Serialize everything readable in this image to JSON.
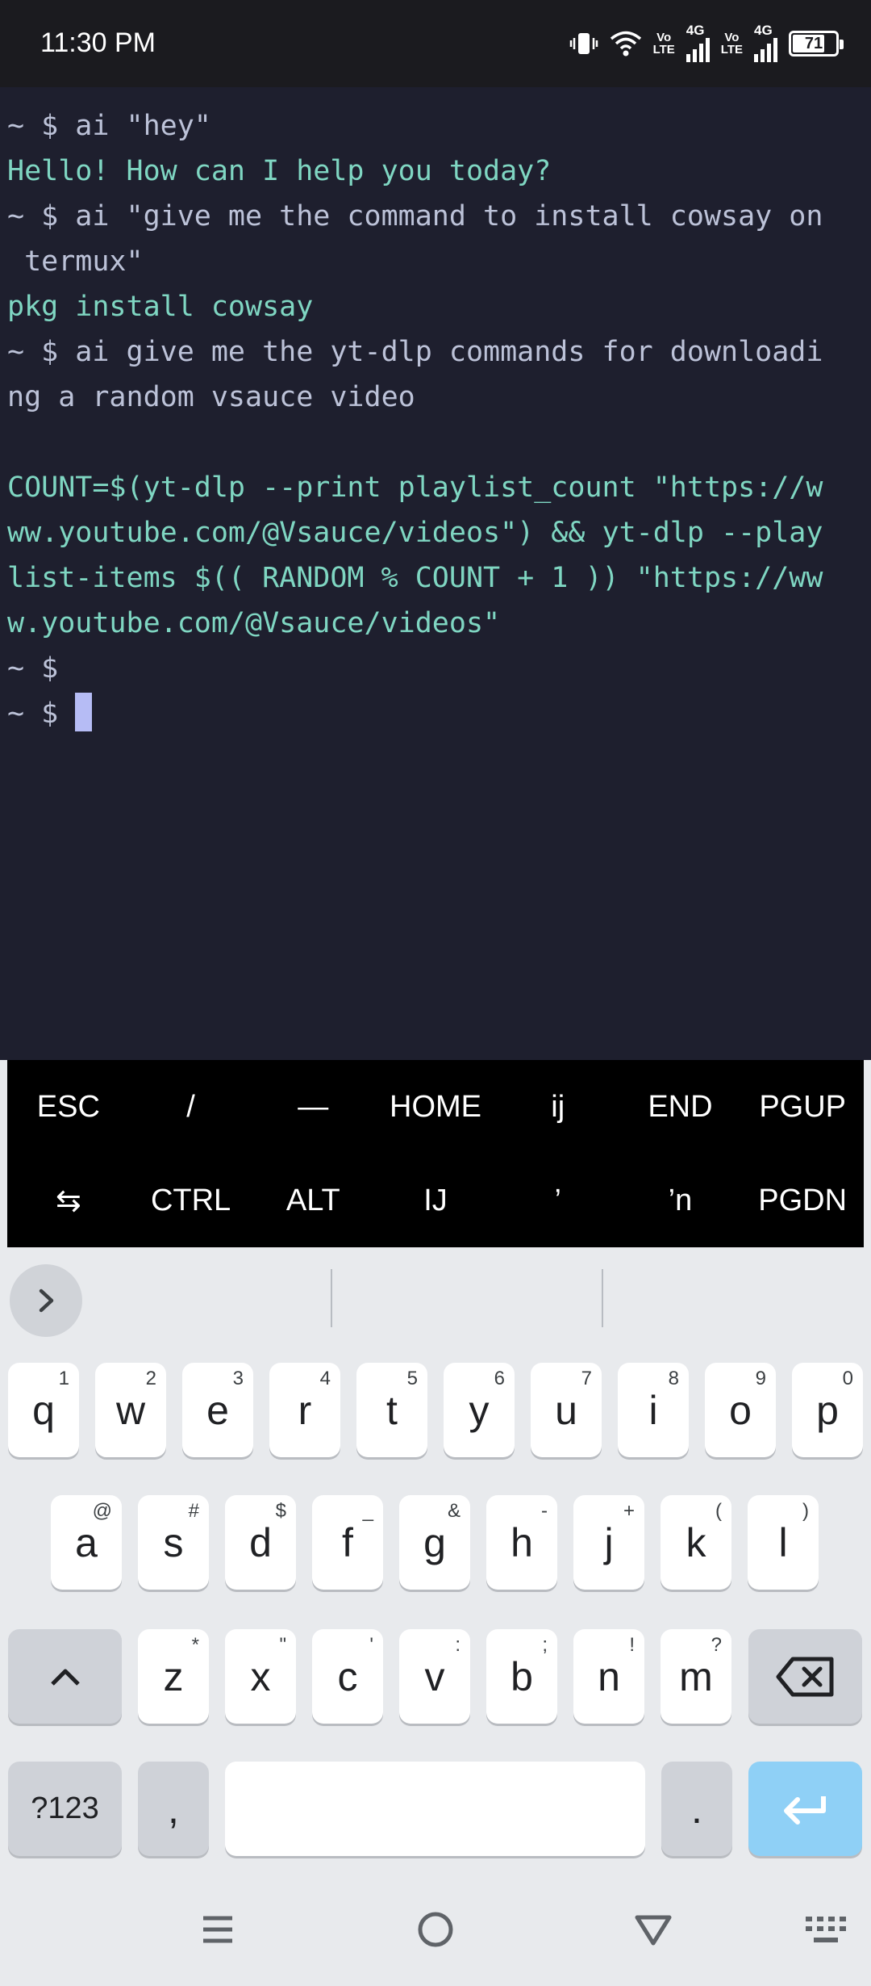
{
  "status_bar": {
    "time": "11:30 PM",
    "net1": "Vo\nLTE",
    "net1_a": "Vo",
    "net1_b": "LTE",
    "gen1": "4G",
    "net2_a": "Vo",
    "net2_b": "LTE",
    "gen2": "4G",
    "battery": "71"
  },
  "terminal": {
    "lines": [
      {
        "text": "~ $ ai \"hey\"",
        "kind": "prompt"
      },
      {
        "text": "Hello! How can I help you today?",
        "kind": "output"
      },
      {
        "text": "~ $ ai \"give me the command to install cowsay on",
        "kind": "prompt"
      },
      {
        "text": " termux\"",
        "kind": "prompt"
      },
      {
        "text": "pkg install cowsay",
        "kind": "output"
      },
      {
        "text": "~ $ ai give me the yt-dlp commands for downloadi",
        "kind": "prompt"
      },
      {
        "text": "ng a random vsauce video",
        "kind": "prompt"
      },
      {
        "text": "",
        "kind": "output"
      },
      {
        "text": "COUNT=$(yt-dlp --print playlist_count \"https://w",
        "kind": "output"
      },
      {
        "text": "ww.youtube.com/@Vsauce/videos\") && yt-dlp --play",
        "kind": "output"
      },
      {
        "text": "list-items $(( RANDOM % COUNT + 1 )) \"https://ww",
        "kind": "output"
      },
      {
        "text": "w.youtube.com/@Vsauce/videos\"",
        "kind": "output"
      },
      {
        "text": "~ $",
        "kind": "prompt"
      },
      {
        "text": "~ $ ",
        "kind": "prompt"
      }
    ]
  },
  "extra_keys": {
    "row1": [
      "ESC",
      "/",
      "—",
      "HOME",
      "ij",
      "END",
      "PGUP"
    ],
    "row2": [
      "⇆",
      "CTRL",
      "ALT",
      "IJ",
      "’",
      "’n",
      "PGDN"
    ]
  },
  "keyboard": {
    "row1": [
      {
        "k": "q",
        "h": "1"
      },
      {
        "k": "w",
        "h": "2"
      },
      {
        "k": "e",
        "h": "3"
      },
      {
        "k": "r",
        "h": "4"
      },
      {
        "k": "t",
        "h": "5"
      },
      {
        "k": "y",
        "h": "6"
      },
      {
        "k": "u",
        "h": "7"
      },
      {
        "k": "i",
        "h": "8"
      },
      {
        "k": "o",
        "h": "9"
      },
      {
        "k": "p",
        "h": "0"
      }
    ],
    "row2": [
      {
        "k": "a",
        "h": "@"
      },
      {
        "k": "s",
        "h": "#"
      },
      {
        "k": "d",
        "h": "$"
      },
      {
        "k": "f",
        "h": "_"
      },
      {
        "k": "g",
        "h": "&"
      },
      {
        "k": "h",
        "h": "-"
      },
      {
        "k": "j",
        "h": "+"
      },
      {
        "k": "k",
        "h": "("
      },
      {
        "k": "l",
        "h": ")"
      }
    ],
    "row3": [
      {
        "k": "z",
        "h": "*"
      },
      {
        "k": "x",
        "h": "\""
      },
      {
        "k": "c",
        "h": "'"
      },
      {
        "k": "v",
        "h": ":"
      },
      {
        "k": "b",
        "h": ";"
      },
      {
        "k": "n",
        "h": "!"
      },
      {
        "k": "m",
        "h": "?"
      }
    ],
    "symbols_label": "?123",
    "comma_label": ",",
    "period_label": ".",
    "space_label": ""
  },
  "colors": {
    "terminal_bg": "#1e1f2e",
    "prompt_text": "#bcc2d8",
    "output_text": "#7fd6c2",
    "cursor": "#b6bcf5",
    "enter_key": "#8fd0f6"
  },
  "icons": {
    "expand": "chevron-right-icon",
    "shift": "shift-icon",
    "backspace": "backspace-icon",
    "enter": "enter-icon",
    "nav_menu": "menu-icon",
    "nav_home": "home-circle-icon",
    "nav_back": "back-triangle-icon",
    "nav_keyboard": "keyboard-icon"
  }
}
